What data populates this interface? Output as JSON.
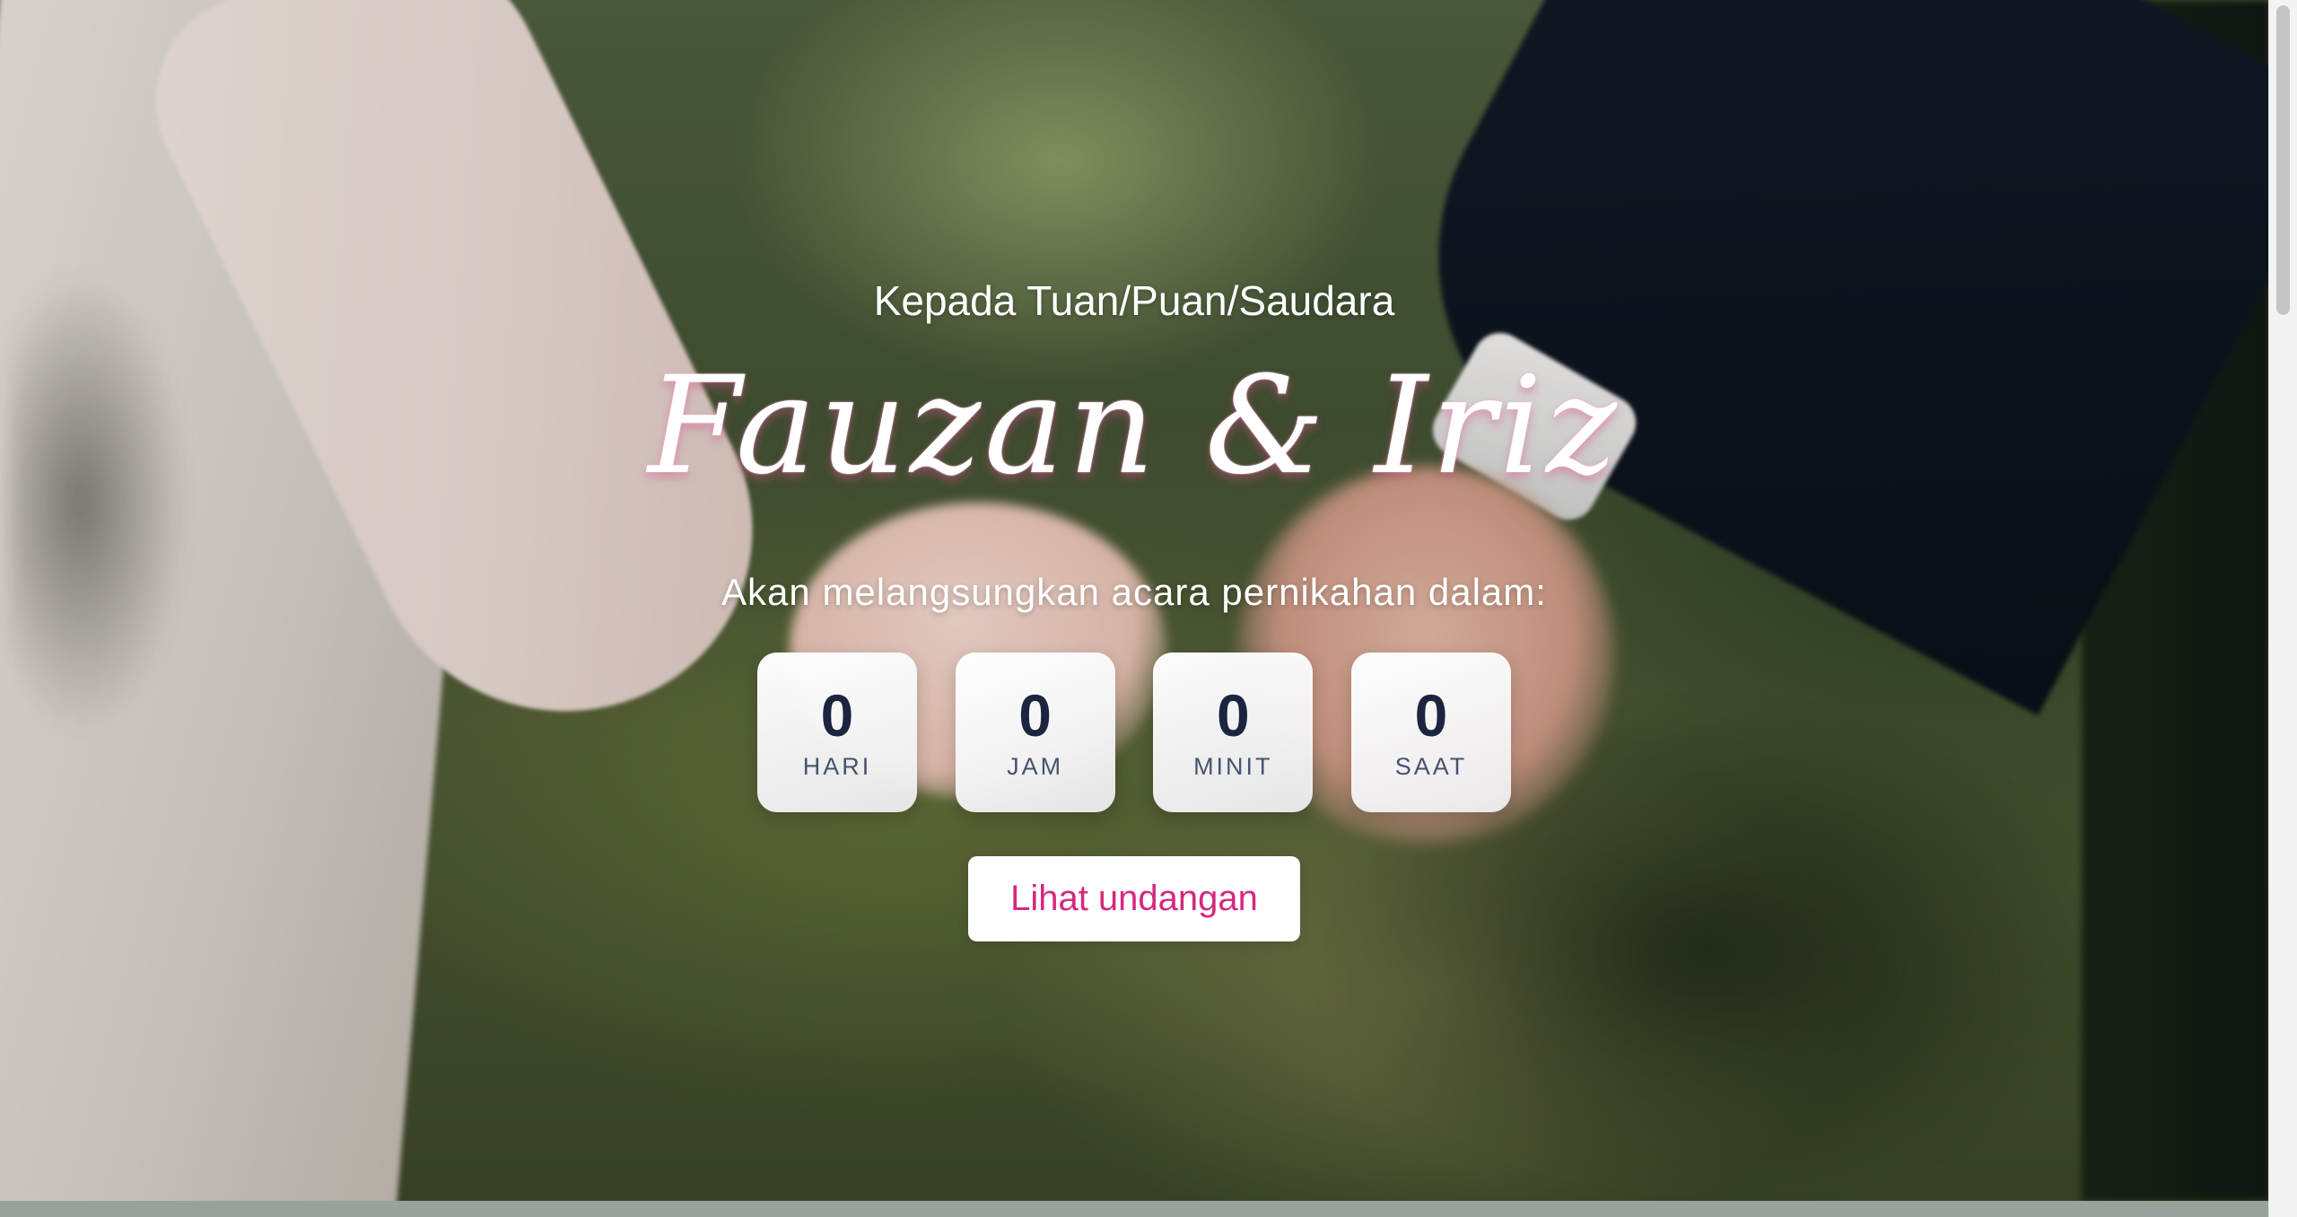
{
  "hero": {
    "greeting": "Kepada Tuan/Puan/Saudara",
    "couple_names": "Fauzan & Iriz",
    "subtitle": "Akan melangsungkan acara pernikahan dalam:"
  },
  "countdown": {
    "days": {
      "value": "0",
      "label": "HARI"
    },
    "hours": {
      "value": "0",
      "label": "JAM"
    },
    "minutes": {
      "value": "0",
      "label": "MINIT"
    },
    "seconds": {
      "value": "0",
      "label": "SAAT"
    }
  },
  "actions": {
    "open_invitation_label": "Lihat undangan"
  },
  "colors": {
    "button_text": "#d6287e",
    "countdown_number": "#1c2540",
    "countdown_label": "#46536f",
    "title_glow": "#f2a8c9"
  }
}
